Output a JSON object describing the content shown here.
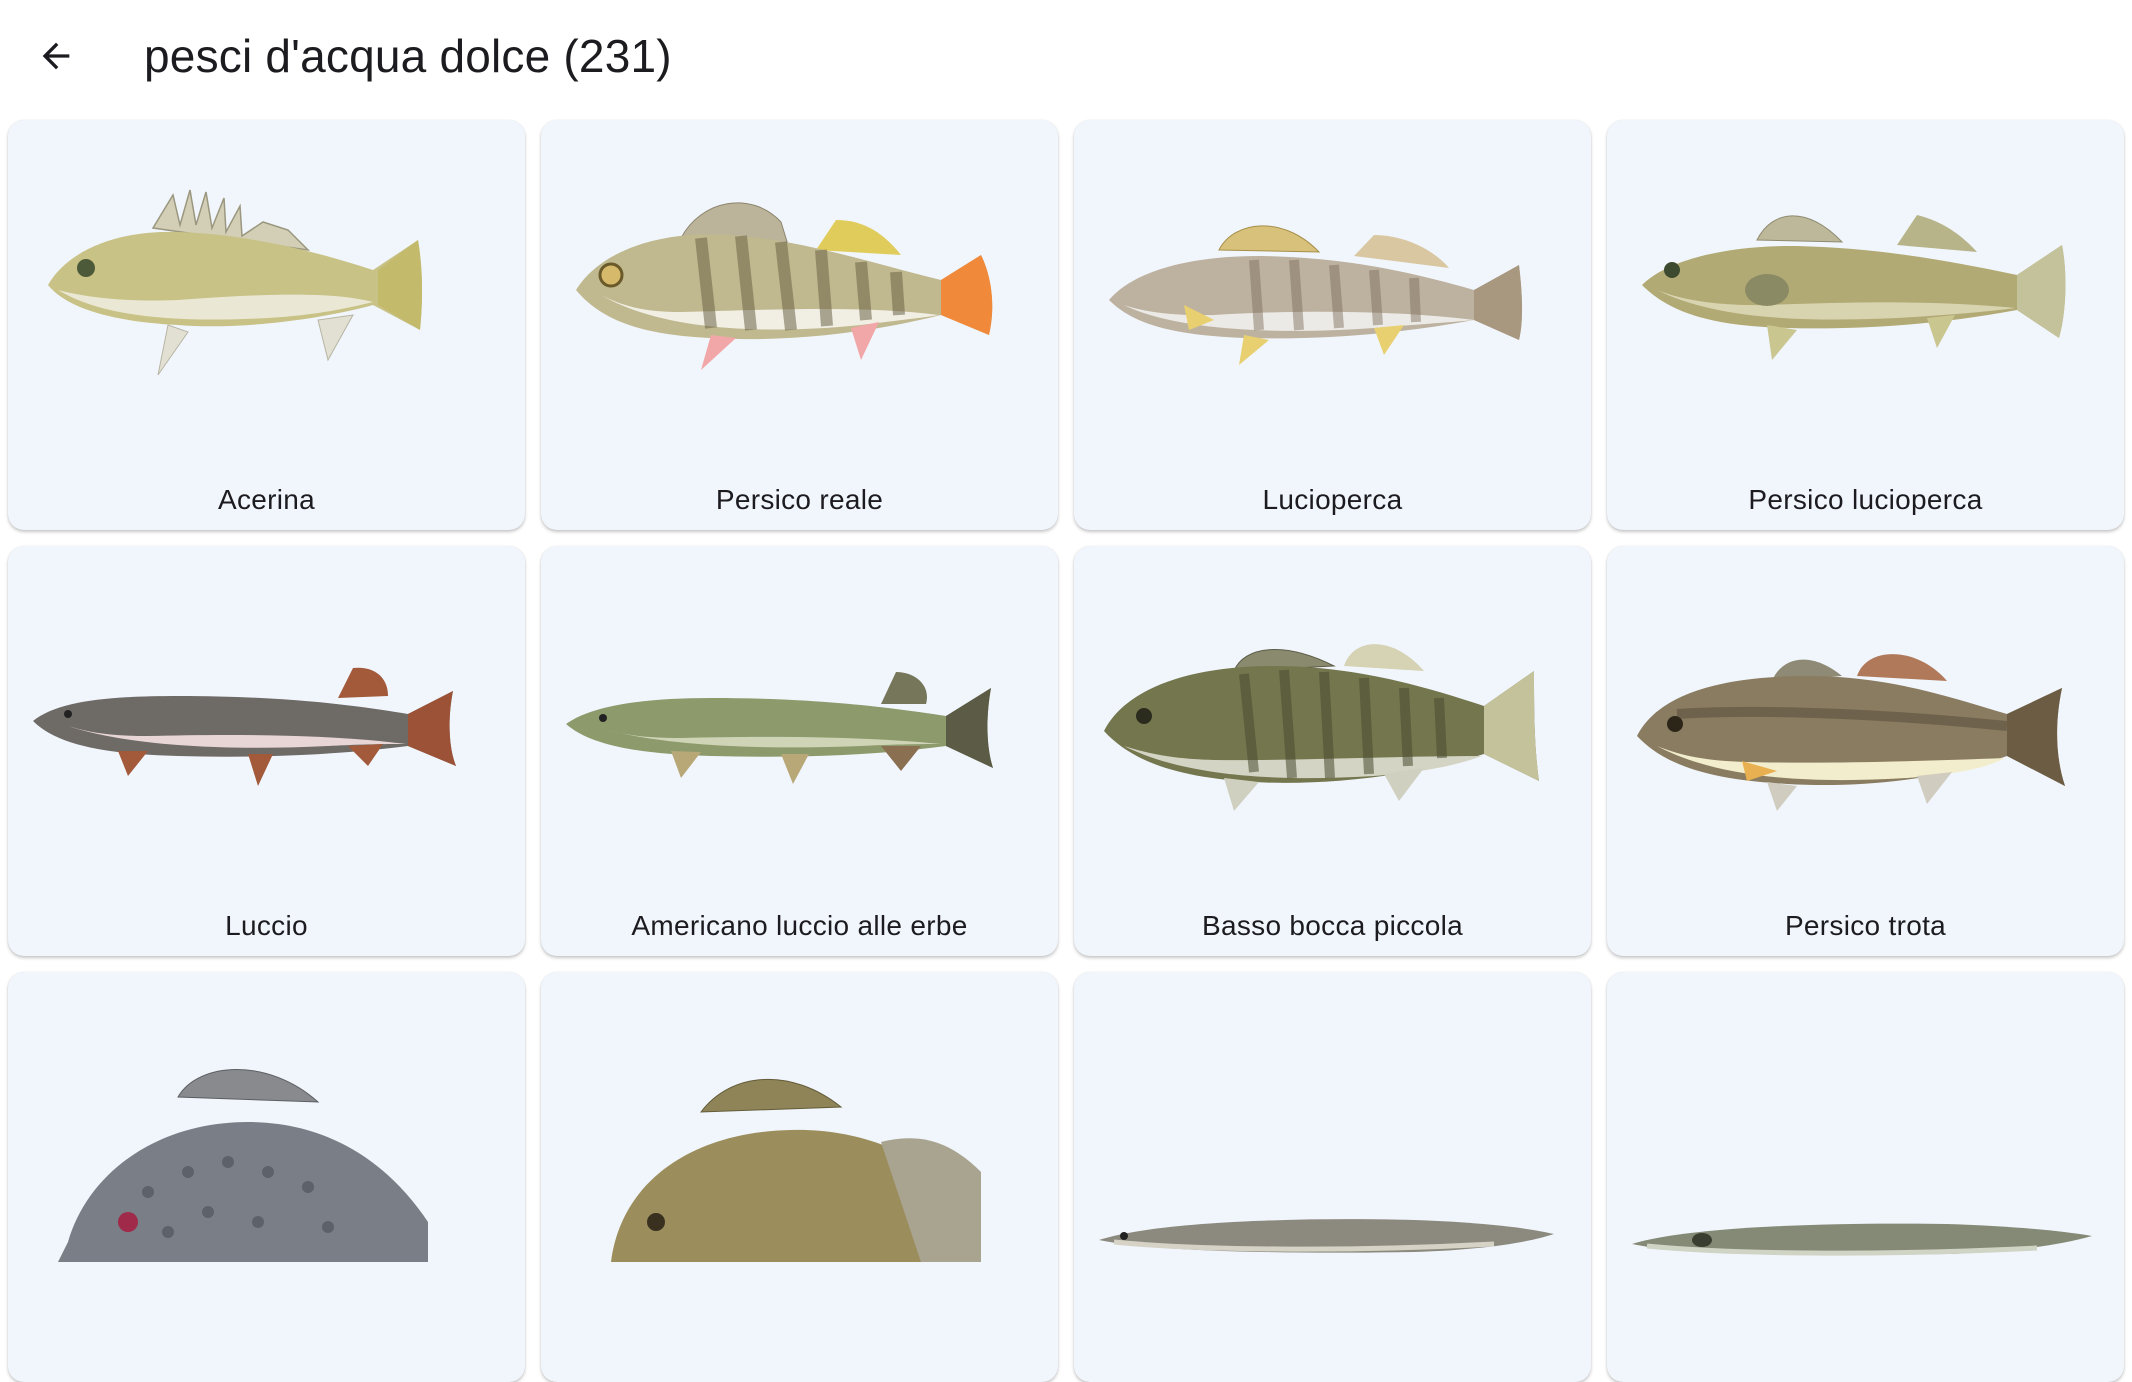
{
  "header": {
    "title": "pesci d'acqua dolce (231)",
    "back_icon": "arrow-back-icon"
  },
  "colors": {
    "card_bg": "#f1f6fd",
    "text": "#1c1b1f"
  },
  "fish": [
    {
      "name": "Acerina",
      "icon": "fish-image-ruffe"
    },
    {
      "name": "Persico reale",
      "icon": "fish-image-perch"
    },
    {
      "name": "Lucioperca",
      "icon": "fish-image-zander"
    },
    {
      "name": "Persico lucioperca",
      "icon": "fish-image-walleye"
    },
    {
      "name": "Luccio",
      "icon": "fish-image-pike"
    },
    {
      "name": "Americano luccio alle erbe",
      "icon": "fish-image-grass-pickerel"
    },
    {
      "name": "Basso bocca piccola",
      "icon": "fish-image-smallmouth-bass"
    },
    {
      "name": "Persico trota",
      "icon": "fish-image-largemouth-bass"
    },
    {
      "name": "",
      "icon": "fish-image-crappie"
    },
    {
      "name": "",
      "icon": "fish-image-sunfish"
    },
    {
      "name": "",
      "icon": "fish-image-eel"
    },
    {
      "name": "",
      "icon": "fish-image-eel-2"
    }
  ]
}
